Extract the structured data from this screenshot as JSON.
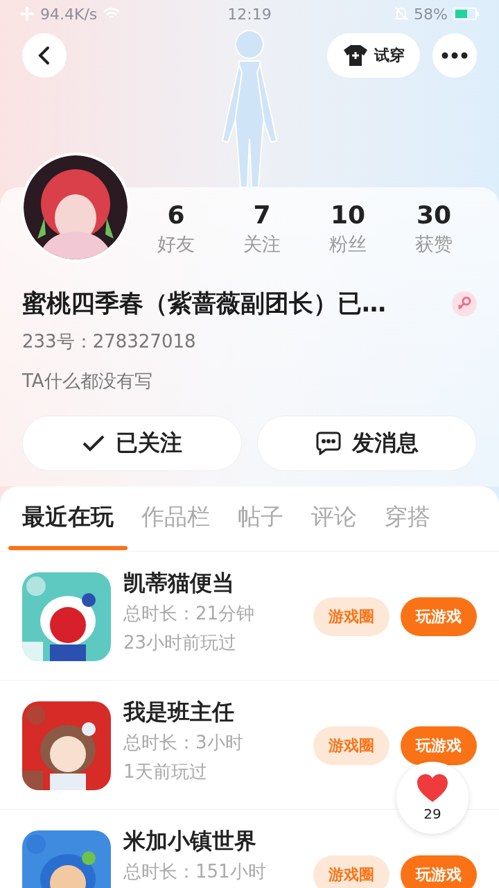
{
  "status_bar": {
    "speed": "94.4K/s",
    "time": "12:19",
    "battery": "58%"
  },
  "header": {
    "try_on": "试穿"
  },
  "profile": {
    "stats": [
      {
        "value": "6",
        "label": "好友"
      },
      {
        "value": "7",
        "label": "关注"
      },
      {
        "value": "10",
        "label": "粉丝"
      },
      {
        "value": "30",
        "label": "获赞"
      }
    ],
    "name": "蜜桃四季春（紫蔷薇副团长）已…",
    "female": true,
    "id": "233号：278327018",
    "bio": "TA什么都没有写"
  },
  "actions": [
    {
      "kind": "follow",
      "label": "已关注"
    },
    {
      "kind": "message",
      "label": "发消息"
    }
  ],
  "tabs": [
    {
      "label": "最近在玩",
      "selected": true
    },
    {
      "label": "作品栏",
      "selected": false
    },
    {
      "label": "帖子",
      "selected": false
    },
    {
      "label": "评论",
      "selected": false
    },
    {
      "label": "穿搭",
      "selected": false
    }
  ],
  "games": [
    {
      "title": "凯蒂猫便当",
      "duration": "总时长：21分钟",
      "last_played": "23小时前玩过",
      "circle_button": "游戏圈",
      "play_button": "玩游戏"
    },
    {
      "title": "我是班主任",
      "duration": "总时长：3小时",
      "last_played": "1天前玩过",
      "circle_button": "游戏圈",
      "play_button": "玩游戏"
    },
    {
      "title": "米加小镇世界",
      "duration": "总时长：151小时",
      "circle_button": "游戏圈",
      "play_button": "玩游戏"
    }
  ],
  "like_button": {
    "count": "29"
  }
}
